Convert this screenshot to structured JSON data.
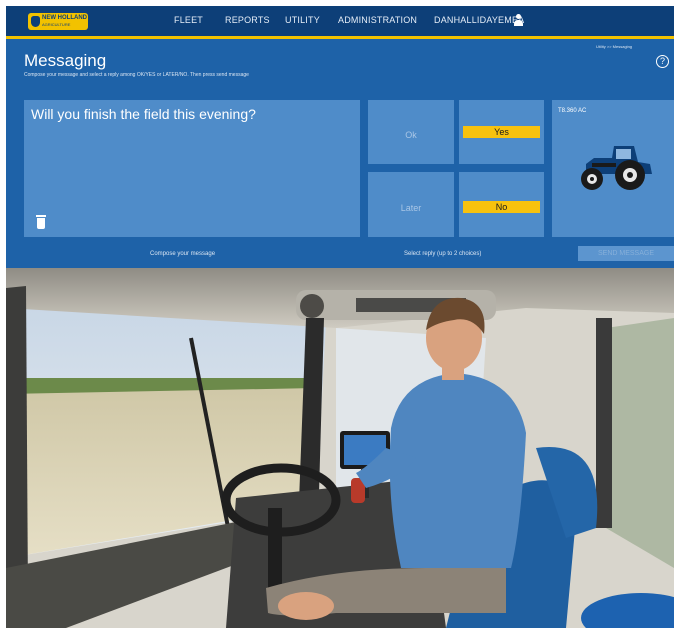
{
  "brand": {
    "name": "NEW HOLLAND",
    "tagline": "AGRICULTURE",
    "colors": {
      "primary": "#1e62a8",
      "dark": "#0d3f78",
      "accent": "#f2c200",
      "tile": "#4f8cc9",
      "selected": "#f7c20e"
    }
  },
  "nav": {
    "items": [
      "FLEET",
      "REPORTS",
      "UTILITY",
      "ADMINISTRATION"
    ],
    "user": "DANHALLIDAYEMEA",
    "user_icon": "user-icon"
  },
  "breadcrumb": "Utility >> Messaging",
  "page": {
    "title": "Messaging",
    "subtitle": "Compose your message and select a reply among OK/YES or LATER/NO. Then press send message",
    "help_icon": "help-icon"
  },
  "compose": {
    "text": "Will you finish the field this evening?",
    "label": "Compose your message",
    "trash_icon": "trash-icon"
  },
  "replies": {
    "label": "Select reply (up to 2 choices)",
    "options": [
      {
        "label": "Ok",
        "selected": false
      },
      {
        "label": "Yes",
        "selected": true
      },
      {
        "label": "Later",
        "selected": false
      },
      {
        "label": "No",
        "selected": true
      }
    ]
  },
  "vehicle": {
    "name": "T8.360 AC",
    "icon": "tractor-icon"
  },
  "send_button": "SEND MESSAGE",
  "photo": {
    "subject": "operator-in-combine-cab"
  }
}
